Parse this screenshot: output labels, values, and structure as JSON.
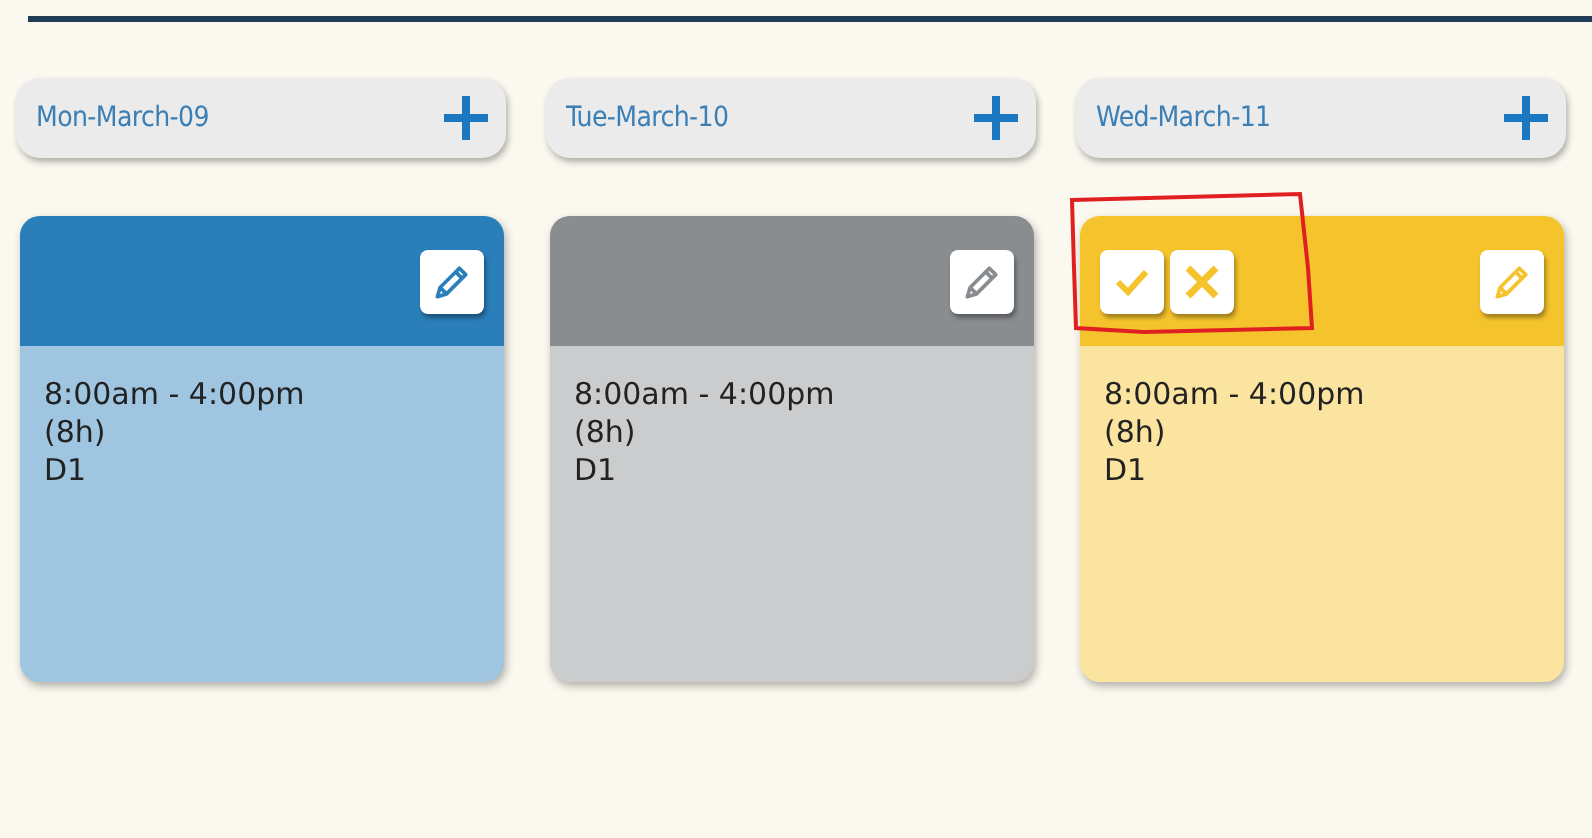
{
  "days": [
    {
      "label": "Mon-March-09",
      "shift": {
        "color": "#2a7fba",
        "time": "8:00am - 4:00pm",
        "hours": "(8h)",
        "code": "D1",
        "pending": false,
        "annotated": false
      }
    },
    {
      "label": "Tue-March-10",
      "shift": {
        "color": "#8a8d90",
        "time": "8:00am - 4:00pm",
        "hours": "(8h)",
        "code": "D1",
        "pending": false,
        "annotated": false
      }
    },
    {
      "label": "Wed-March-11",
      "shift": {
        "color": "#f5c42c",
        "time": "8:00am - 4:00pm",
        "hours": "(8h)",
        "code": "D1",
        "pending": true,
        "annotated": true
      }
    }
  ]
}
